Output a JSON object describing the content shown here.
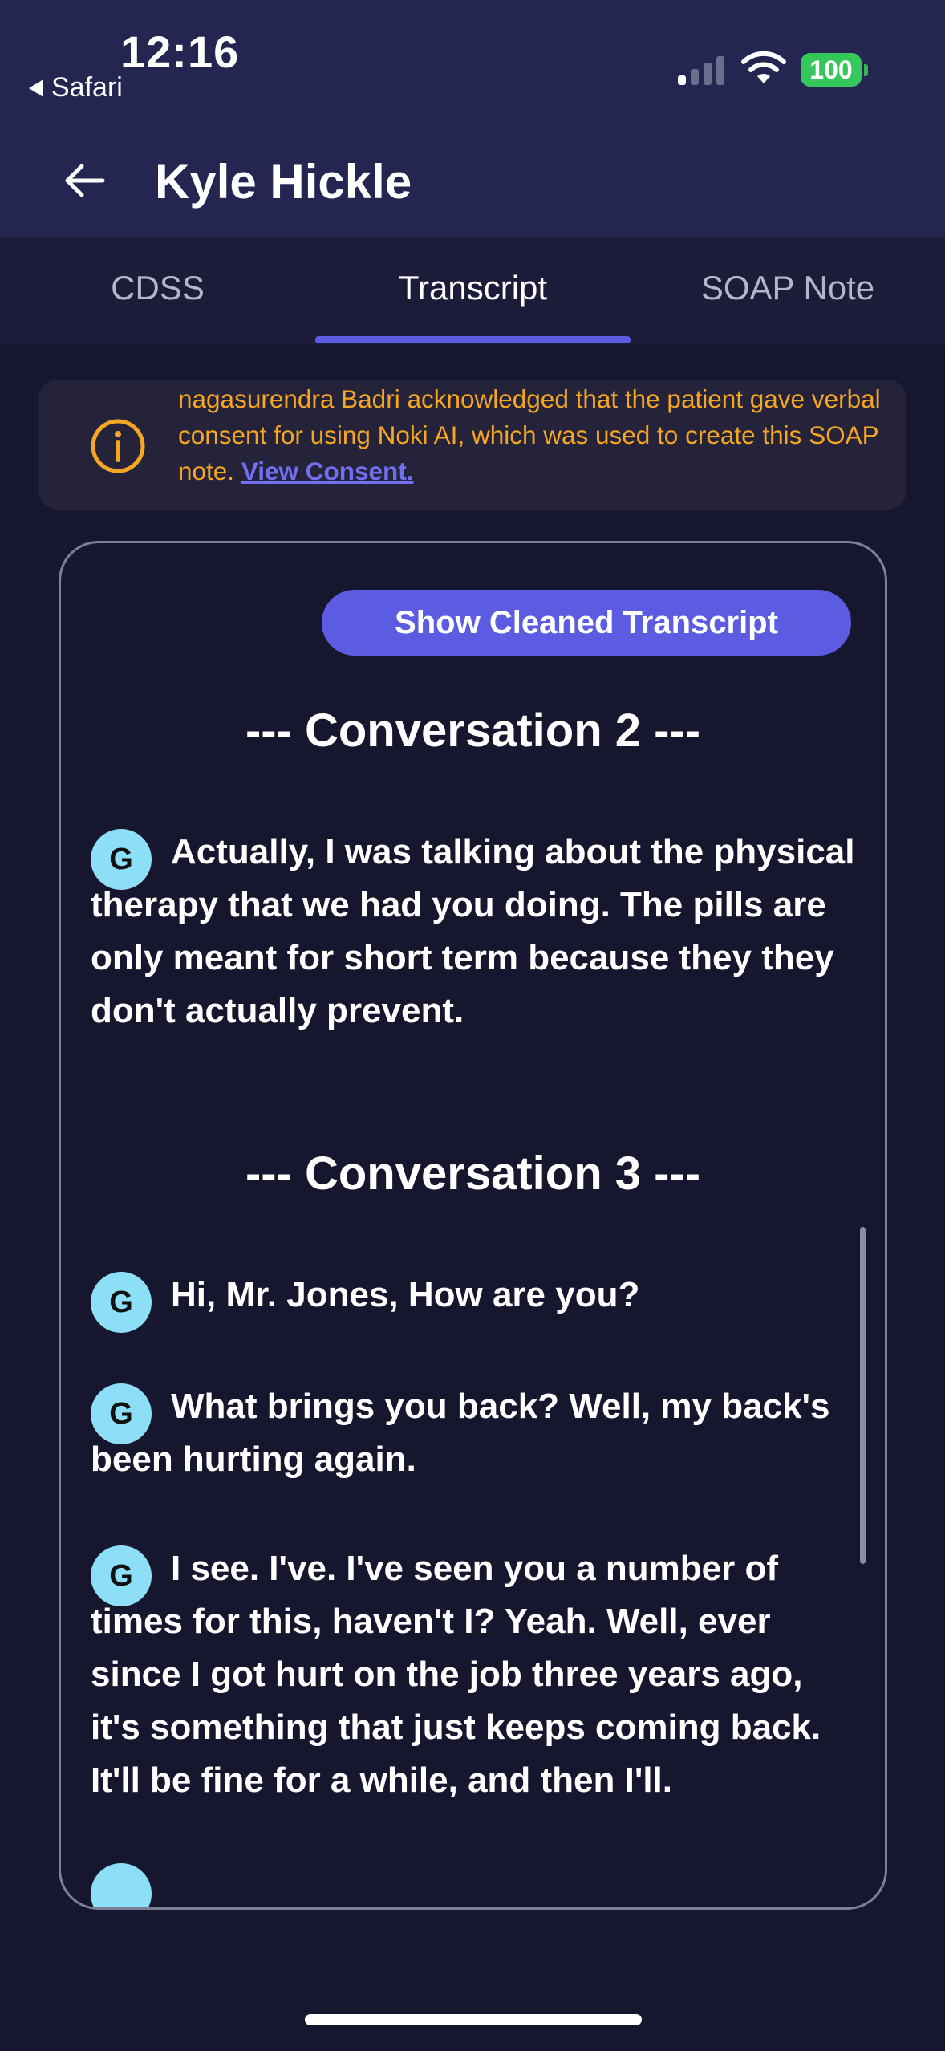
{
  "status_bar": {
    "time": "12:16",
    "back_app": "Safari",
    "battery": "100",
    "icons": [
      "signal-icon",
      "wifi-icon",
      "battery-icon"
    ]
  },
  "header": {
    "title": "Kyle Hickle",
    "back_icon": "arrow-left-icon"
  },
  "tabs": [
    {
      "label": "CDSS",
      "active": false
    },
    {
      "label": "Transcript",
      "active": true
    },
    {
      "label": "SOAP Note",
      "active": false
    }
  ],
  "consent": {
    "icon": "info-icon",
    "text": "nagasurendra Badri acknowledged that the patient gave verbal consent for using Noki AI, which was used to create this SOAP note.",
    "link": "View Consent."
  },
  "transcript": {
    "toggle_button": "Show Cleaned Transcript",
    "conversations": [
      {
        "heading": "--- Conversation 2 ---",
        "messages": [
          {
            "speaker": "G",
            "text": "Actually, I was talking about the physical therapy that we had you doing. The pills are only meant for short term because they they don't actually prevent."
          }
        ]
      },
      {
        "heading": "--- Conversation 3 ---",
        "messages": [
          {
            "speaker": "G",
            "text": "Hi, Mr. Jones, How are you?"
          },
          {
            "speaker": "G",
            "text": "What brings you back? Well, my back's been hurting again."
          },
          {
            "speaker": "G",
            "text": "I see. I've. I've seen you a number of times for this, haven't I? Yeah. Well, ever since I got hurt on the job three years ago, it's something that just keeps coming back. It'll be fine for a while, and then I'll."
          }
        ]
      }
    ]
  },
  "colors": {
    "header_bg": "#242550",
    "page_bg": "#16162e",
    "accent": "#5b5ce2",
    "consent_text": "#f5a623",
    "avatar": "#8ddff7"
  }
}
